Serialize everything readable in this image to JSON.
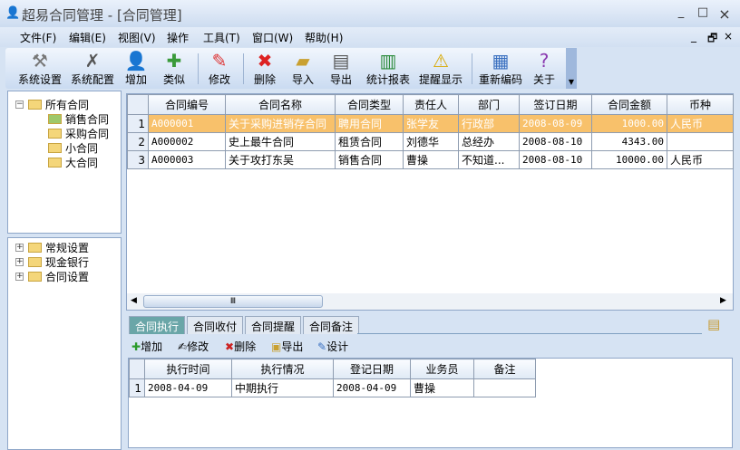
{
  "window": {
    "title": "超易合同管理 - [合同管理]",
    "minimize": "_",
    "maximize": "□",
    "close": "×",
    "mdi_min": "_",
    "mdi_restore": "🗗",
    "mdi_close": "×"
  },
  "menu": [
    "文件(F)",
    "编辑(E)",
    "视图(V)",
    "操作",
    "工具(T)",
    "窗口(W)",
    "帮助(H)"
  ],
  "toolbar": [
    {
      "label": "系统设置",
      "icon": "tools-icon"
    },
    {
      "label": "系统配置",
      "icon": "wrench-icon"
    },
    {
      "label": "增加",
      "icon": "add-user-icon"
    },
    {
      "label": "类似",
      "icon": "copy-icon"
    },
    {
      "label": "修改",
      "icon": "pencil-icon"
    },
    {
      "label": "删除",
      "icon": "delete-icon"
    },
    {
      "label": "导入",
      "icon": "import-icon"
    },
    {
      "label": "导出",
      "icon": "export-icon"
    },
    {
      "label": "统计报表",
      "icon": "chart-icon"
    },
    {
      "label": "提醒显示",
      "icon": "alert-icon"
    },
    {
      "label": "重新编码",
      "icon": "calendar-icon"
    },
    {
      "label": "关于",
      "icon": "help-icon"
    }
  ],
  "tree1": {
    "root": "所有合同",
    "children": [
      "销售合同",
      "采购合同",
      "小合同",
      "大合同"
    ]
  },
  "tree2": [
    "常规设置",
    "现金银行",
    "合同设置"
  ],
  "grid": {
    "columns": [
      "合同编号",
      "合同名称",
      "合同类型",
      "责任人",
      "部门",
      "签订日期",
      "合同金额",
      "币种"
    ],
    "rows": [
      [
        "1",
        "A000001",
        "关于采购进销存合同",
        "聘用合同",
        "张学友",
        "行政部",
        "2008-08-09",
        "1000.00",
        "人民币"
      ],
      [
        "2",
        "A000002",
        "史上最牛合同",
        "租赁合同",
        "刘德华",
        "总经办",
        "2008-08-10",
        "4343.00",
        ""
      ],
      [
        "3",
        "A000003",
        "关于攻打东吴",
        "销售合同",
        "曹操",
        "不知道...",
        "2008-08-10",
        "10000.00",
        "人民币"
      ]
    ],
    "scroll_thumb": "Ⅲ"
  },
  "tabs": [
    "合同执行",
    "合同收付",
    "合同提醒",
    "合同备注"
  ],
  "subtoolbar": [
    "增加",
    "修改",
    "删除",
    "导出",
    "设计"
  ],
  "subgrid": {
    "columns": [
      "执行时间",
      "执行情况",
      "登记日期",
      "业务员",
      "备注"
    ],
    "rows": [
      [
        "1",
        "2008-04-09",
        "中期执行",
        "2008-04-09",
        "曹操",
        ""
      ]
    ]
  },
  "colors": {
    "selected_row": "#f8c16b",
    "active_tab": "#6aa6a8"
  }
}
